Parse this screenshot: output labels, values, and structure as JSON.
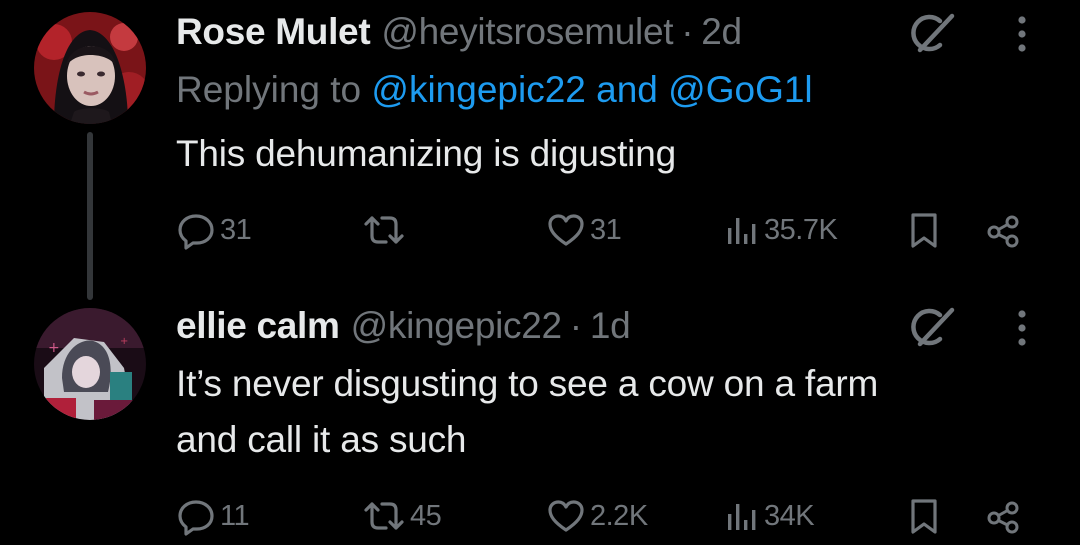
{
  "tweets": [
    {
      "author_name": "Rose Mulet",
      "author_handle": "@heyitsrosemulet",
      "separator": "·",
      "time": "2d",
      "replying_prefix": "Replying to",
      "replying_mention_1": "@kingepic22",
      "replying_and": "and",
      "replying_mention_2": "@GoG1l",
      "text_lines": [
        "This dehumanizing is digusting"
      ],
      "replies": "31",
      "reposts": "",
      "likes": "31",
      "views": "35.7K"
    },
    {
      "author_name": "ellie calm",
      "author_handle": "@kingepic22",
      "separator": "·",
      "time": "1d",
      "text_lines": [
        "It’s never disgusting to see a cow on a farm",
        "and call it as such"
      ],
      "replies": "11",
      "reposts": "45",
      "likes": "2.2K",
      "views": "34K"
    }
  ],
  "colors": {
    "background": "#000000",
    "primary_text": "#e7e9ea",
    "secondary_text": "#71767b",
    "link": "#1d9bf0",
    "thread_line": "#333639"
  },
  "icons": [
    "reply-icon",
    "repost-icon",
    "like-icon",
    "views-icon",
    "bookmark-icon",
    "share-icon",
    "grok-icon",
    "more-icon"
  ]
}
